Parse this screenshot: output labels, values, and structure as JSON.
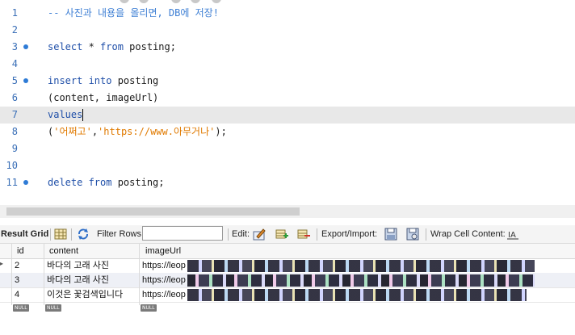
{
  "editor": {
    "lines": [
      {
        "n": "1",
        "dot": false,
        "parts": [
          {
            "c": "cm",
            "t": "-- 사진과 내용을 올리면, DB에 저장!"
          }
        ]
      },
      {
        "n": "2",
        "dot": false,
        "parts": []
      },
      {
        "n": "3",
        "dot": true,
        "parts": [
          {
            "c": "kw",
            "t": "select"
          },
          {
            "c": "",
            "t": " * "
          },
          {
            "c": "kw",
            "t": "from"
          },
          {
            "c": "",
            "t": " posting;"
          }
        ]
      },
      {
        "n": "4",
        "dot": false,
        "parts": []
      },
      {
        "n": "5",
        "dot": true,
        "parts": [
          {
            "c": "kw",
            "t": "insert into"
          },
          {
            "c": "",
            "t": " posting"
          }
        ]
      },
      {
        "n": "6",
        "dot": false,
        "parts": [
          {
            "c": "",
            "t": "(content, imageUrl)"
          }
        ]
      },
      {
        "n": "7",
        "dot": false,
        "current": true,
        "parts": [
          {
            "c": "kw",
            "t": "values"
          }
        ]
      },
      {
        "n": "8",
        "dot": false,
        "parts": [
          {
            "c": "",
            "t": "("
          },
          {
            "c": "str",
            "t": "'어쩌고'"
          },
          {
            "c": "",
            "t": ","
          },
          {
            "c": "str",
            "t": "'https://www.아무거나'"
          },
          {
            "c": "",
            "t": ");"
          }
        ]
      },
      {
        "n": "9",
        "dot": false,
        "parts": []
      },
      {
        "n": "10",
        "dot": false,
        "parts": []
      },
      {
        "n": "11",
        "dot": true,
        "parts": [
          {
            "c": "kw",
            "t": "delete from"
          },
          {
            "c": "",
            "t": " posting;"
          }
        ]
      }
    ]
  },
  "result_toolbar": {
    "title": "Result Grid",
    "filter_label": "Filter Rows:",
    "filter_value": "",
    "edit_label": "Edit:",
    "export_label": "Export/Import:",
    "wrap_label": "Wrap Cell Content:"
  },
  "grid": {
    "columns": [
      "id",
      "content",
      "imageUrl"
    ],
    "rows": [
      {
        "id": "2",
        "content": "바다의 고래 사진",
        "imageUrl": "https://leop"
      },
      {
        "id": "3",
        "content": "바다의 고래 사진",
        "imageUrl": "https://leop"
      },
      {
        "id": "4",
        "content": "이것은 꽃검색입니다",
        "imageUrl": "https://leop"
      }
    ],
    "null_label": "NULL"
  },
  "colors": {
    "keyword": "#1f4fa8",
    "comment": "#3e7fd4",
    "string": "#e07a00",
    "line_number": "#3a6fb7"
  }
}
